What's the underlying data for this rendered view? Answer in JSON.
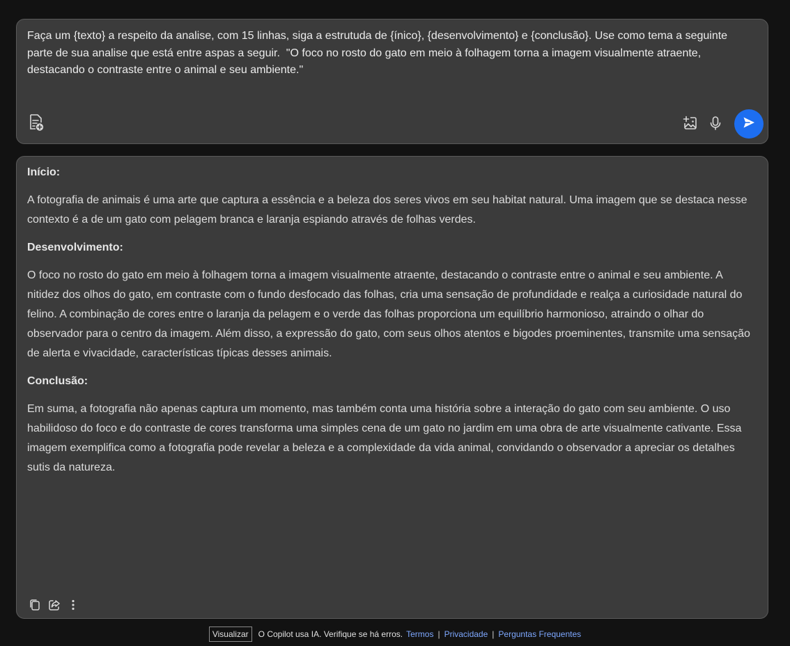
{
  "prompt": {
    "text": "Faça um {texto} a respeito da analise, com 15 linhas, siga a estrutuda de {ínico}, {desenvolvimento} e {conclusão}. Use como tema a seguinte parte de sua analise que está entre aspas a seguir.  \"O foco no rosto do gato em meio à folhagem torna a imagem visualmente atraente, destacando o contraste entre o animal e seu ambiente.\""
  },
  "prompt_toolbar": {
    "left_icons": [
      "document-add-icon"
    ],
    "right_icons": [
      "image-add-icon",
      "microphone-icon",
      "send-icon"
    ]
  },
  "response": {
    "sections": [
      {
        "heading": "Início:",
        "paragraph": "A fotografia de animais é uma arte que captura a essência e a beleza dos seres vivos em seu habitat natural. Uma imagem que se destaca nesse contexto é a de um gato com pelagem branca e laranja espiando através de folhas verdes."
      },
      {
        "heading": "Desenvolvimento:",
        "paragraph": "O foco no rosto do gato em meio à folhagem torna a imagem visualmente atraente, destacando o contraste entre o animal e seu ambiente. A nitidez dos olhos do gato, em contraste com o fundo desfocado das folhas, cria uma sensação de profundidade e realça a curiosidade natural do felino. A combinação de cores entre o laranja da pelagem e o verde das folhas proporciona um equilíbrio harmonioso, atraindo o olhar do observador para o centro da imagem. Além disso, a expressão do gato, com seus olhos atentos e bigodes proeminentes, transmite uma sensação de alerta e vivacidade, características típicas desses animais."
      },
      {
        "heading": "Conclusão:",
        "paragraph": "Em suma, a fotografia não apenas captura um momento, mas também conta uma história sobre a interação do gato com seu ambiente. O uso habilidoso do foco e do contraste de cores transforma uma simples cena de um gato no jardim em uma obra de arte visualmente cativante. Essa imagem exemplifica como a fotografia pode revelar a beleza e a complexidade da vida animal, convidando o observador a apreciar os detalhes sutis da natureza."
      }
    ],
    "action_icons": [
      "copy-icon",
      "share-icon",
      "more-options-icon"
    ]
  },
  "footer": {
    "visualize_label": "Visualizar",
    "notice": "O Copilot usa IA. Verifique se há erros.",
    "links": [
      "Termos",
      "Privacidade",
      "Perguntas Frequentes"
    ],
    "separator": "|"
  },
  "colors": {
    "background": "#121212",
    "card": "#3b3b3b",
    "send_button": "#1d6ef0",
    "link": "#7ea8ff"
  }
}
